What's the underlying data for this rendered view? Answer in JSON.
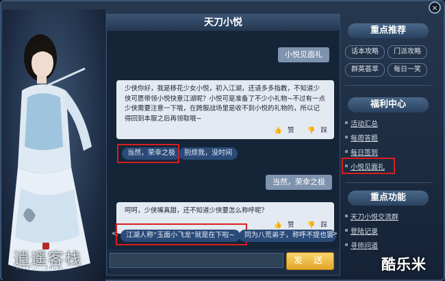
{
  "window": {
    "title": "天刀小悦",
    "close_glyph": "×"
  },
  "portrait": {
    "logo_text": "逍遥客栈",
    "logo_sub": "HTTP://...ZHUBI..."
  },
  "chat": {
    "messages": [
      {
        "side": "right",
        "text": "小悦见面礼"
      },
      {
        "side": "left",
        "text": "少侠你好，我是移花少女小悦，初入江湖，还请多多指教，不知道少侠可愿带领小悦快意江湖呢？小悦可是准备了不少小礼物~不过有一点少侠需要注意一下哦，在跨服战场里是收不到小悦的礼物的，所以记得回到本服之后再领取哦~",
        "like": "赞",
        "dislike": "踩"
      },
      {
        "side": "right",
        "text": "当然，荣幸之极"
      },
      {
        "side": "left",
        "text": "呵呵，少侠嘴真甜，还不知道少侠要怎么称呼呢？",
        "like": "赞",
        "dislike": "踩"
      }
    ],
    "choices_1": [
      "当然，荣幸之极",
      "别烦我，没时间"
    ],
    "choices_2": [
      "江湖人称“玉面小飞龙”就是在下啦~",
      "同为八荒弟子，称呼不提也罢"
    ],
    "input_placeholder": "",
    "send_label": "发 送",
    "prev_arrow": "<",
    "next_arrow": ">"
  },
  "sidebar": {
    "recommend": {
      "title": "重点推荐",
      "items": [
        "话本攻略",
        "门派攻略",
        "群英荟萃",
        "每日一笑"
      ]
    },
    "welfare": {
      "title": "福利中心",
      "items": [
        "活动汇总",
        "每周答题",
        "每日签到",
        "小悦见面礼"
      ]
    },
    "features": {
      "title": "重点功能",
      "items": [
        "天刀小悦交流群",
        "登陆记录",
        "寻师问道"
      ]
    }
  },
  "watermark": "酷乐米",
  "colors": {
    "highlight": "#d81f1f",
    "accent_send": "#e3a62a",
    "chip": "#2a4a78"
  }
}
